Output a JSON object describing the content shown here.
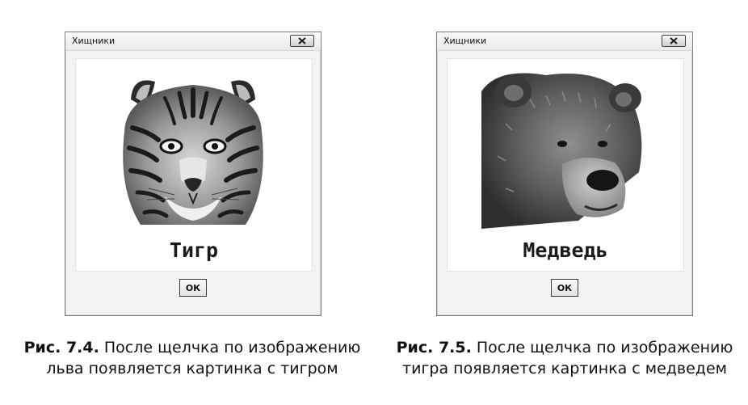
{
  "windows": [
    {
      "title": "Хищники",
      "picture": "tiger-picture",
      "caption": "Тигр",
      "ok_label": "ОК"
    },
    {
      "title": "Хищники",
      "picture": "bear-picture",
      "caption": "Медведь",
      "ok_label": "ОК"
    }
  ],
  "figures": [
    {
      "number": "Рис. 7.4.",
      "line1": "После щелчка по изображению",
      "line2": "льва появляется картинка с тигром"
    },
    {
      "number": "Рис. 7.5.",
      "line1": "После щелчка по изображению",
      "line2": "тигра появляется картинка с медведем"
    }
  ]
}
